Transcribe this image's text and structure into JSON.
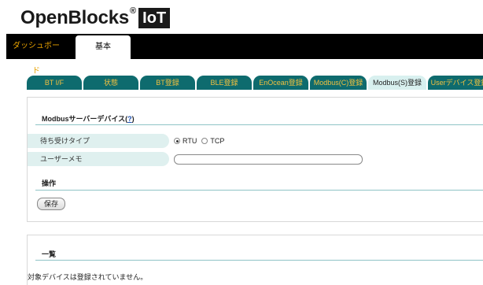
{
  "brand": {
    "name": "OpenBlocks",
    "reg": "®",
    "badge": "IoT"
  },
  "topnav": {
    "tabs": [
      {
        "label": "ダッシュボード"
      },
      {
        "label": "基本"
      }
    ]
  },
  "subtabs": [
    {
      "label": "BT I/F"
    },
    {
      "label": "状態"
    },
    {
      "label": "BT登録"
    },
    {
      "label": "BLE登録"
    },
    {
      "label": "EnOcean登録"
    },
    {
      "label": "Modbus(C)登録"
    },
    {
      "label": "Modbus(S)登録"
    },
    {
      "label": "Userデバイス登録"
    }
  ],
  "modbus_section": {
    "title": "Modbusサーバーデバイス(",
    "help_link": "?",
    "title_end": ")",
    "fields": {
      "wait_type": {
        "label": "待ち受けタイプ",
        "options": [
          {
            "label": "RTU",
            "selected": true
          },
          {
            "label": "TCP",
            "selected": false
          }
        ]
      },
      "user_memo": {
        "label": "ユーザーメモ",
        "value": ""
      }
    },
    "operation": {
      "title": "操作",
      "save_label": "保存"
    }
  },
  "list_section": {
    "title": "一覧",
    "empty_message": "対象デバイスは登録されていません。"
  },
  "colors": {
    "tab_bg": "#0e6b6e",
    "tab_text": "#f0c040",
    "active_tab_bg": "#d8f0ef",
    "topbar_bg": "#000000",
    "dashboard_text": "#e8a200",
    "label_bg": "#dff0ef"
  }
}
